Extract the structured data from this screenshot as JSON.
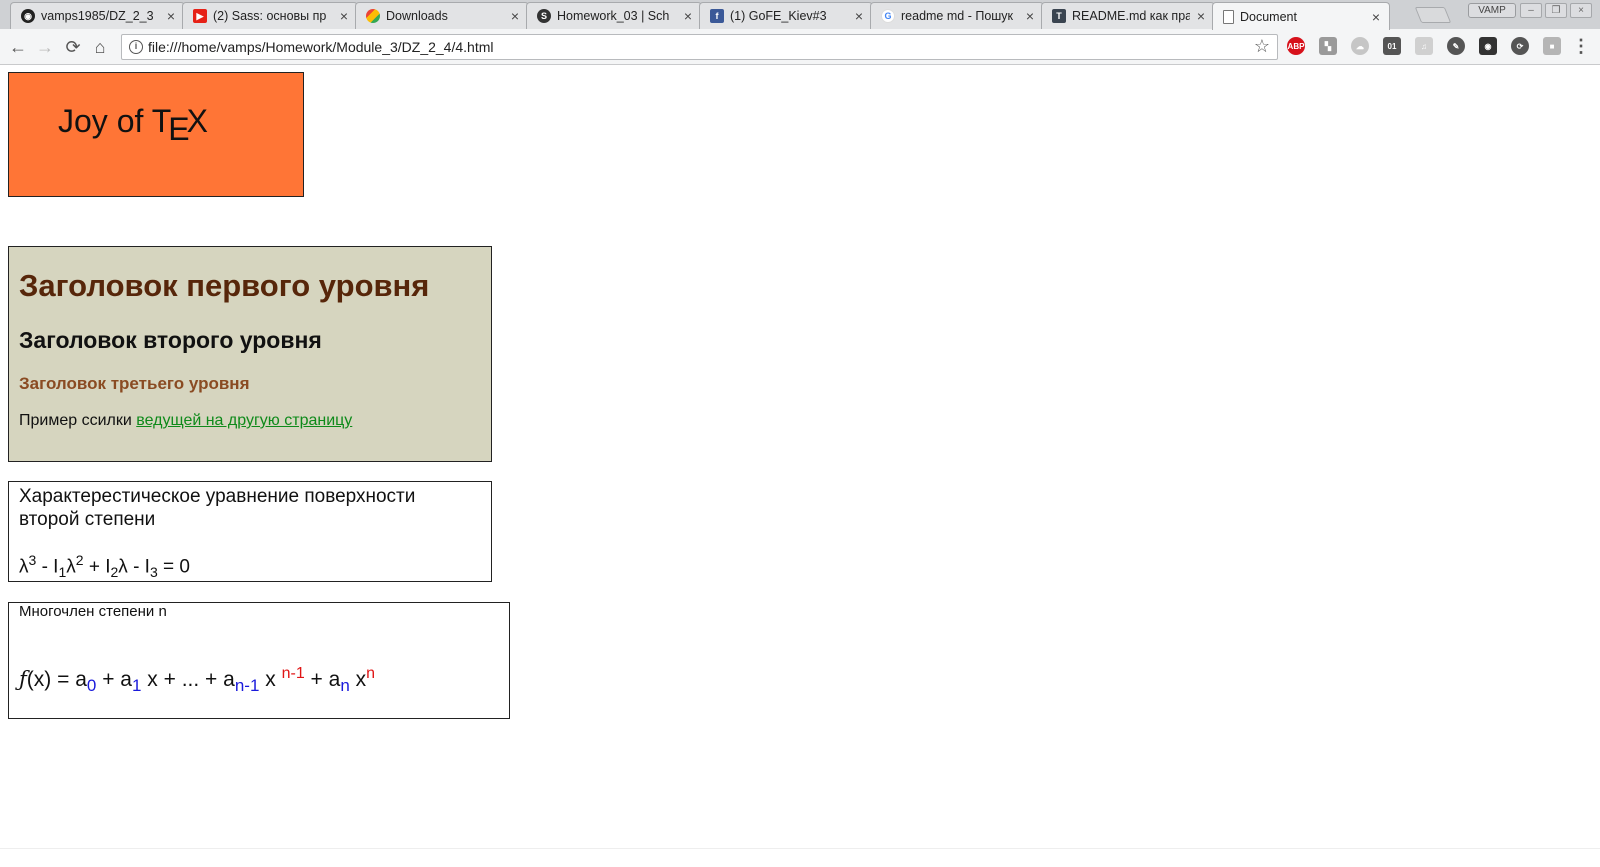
{
  "browser": {
    "tabs": [
      {
        "title": "vamps1985/DZ_2_3",
        "favicon": "github-icon",
        "color": "#222222",
        "glyph": "⬤"
      },
      {
        "title": "(2) Sass: основы пр",
        "favicon": "youtube-icon",
        "color": "#e62117",
        "glyph": "▶"
      },
      {
        "title": "Downloads",
        "favicon": "downloads-icon",
        "color": "#4285f4",
        "glyph": "◆"
      },
      {
        "title": "Homework_03 | Sch",
        "favicon": "schoology-icon",
        "color": "#333333",
        "glyph": "S"
      },
      {
        "title": "(1) GoFE_Kiev#3",
        "favicon": "facebook-icon",
        "color": "#3b5998",
        "glyph": "f"
      },
      {
        "title": "readme md - Пошук",
        "favicon": "google-icon",
        "color": "#4285f4",
        "glyph": "G"
      },
      {
        "title": "README.md как пра",
        "favicon": "habr-icon",
        "color": "#3a4450",
        "glyph": "T"
      },
      {
        "title": "Document",
        "favicon": "document-icon",
        "color": "#777777",
        "glyph": "▢"
      }
    ],
    "active_tab_index": 7,
    "profile_label": "VAMP",
    "address": "file:///home/vamps/Homework/Module_3/DZ_2_4/4.html",
    "extensions": [
      {
        "name": "adblock-plus-icon",
        "label": "ABP",
        "color": "#d7111b"
      },
      {
        "name": "feed-icon",
        "label": "▚",
        "color": "#9a9a9a"
      },
      {
        "name": "cloud-icon",
        "label": "☁",
        "color": "#bdbdbd"
      },
      {
        "name": "binary-icon",
        "label": "01",
        "color": "#555555"
      },
      {
        "name": "music-icon",
        "label": "♫",
        "color": "#c9c9c9"
      },
      {
        "name": "feather-icon",
        "label": "✎",
        "color": "#555555"
      },
      {
        "name": "incognito-icon",
        "label": "◉",
        "color": "#333333"
      },
      {
        "name": "sync-icon",
        "label": "⟳",
        "color": "#555555"
      },
      {
        "name": "shield-icon",
        "label": "■",
        "color": "#b5b5b5"
      },
      {
        "name": "menu-icon",
        "label": "⋮",
        "color": "#555555"
      }
    ]
  },
  "page": {
    "tex": {
      "prefix": "Joy of T",
      "e": "E",
      "suffix": "X"
    },
    "headings": {
      "h1": "Заголовок первого уровня",
      "h2": "Заголовок второго уровня",
      "h3": "Заголовок третьего уровня",
      "link_prefix": "Пример ссилки",
      "link_text": "ведущей на другую страницу"
    },
    "equation": {
      "caption": "Характерестическое уравнение поверхности второй степени",
      "parts": {
        "lambda": "λ",
        "p3": "3",
        "minus_i": " - I",
        "s1": "1",
        "lambda2": "λ",
        "p2": "2",
        "plus_i": " + I",
        "s2": "2",
        "lambda3": "λ",
        "minus_i3": " - I",
        "s3": "3",
        "eq0": " = 0"
      }
    },
    "polynomial": {
      "caption": "Многочлен степени n",
      "parts": {
        "f": "ƒ",
        "fx": "(x) = a",
        "s0": "0",
        "plus_a1": " + a",
        "s1": "1",
        "x_dots": " x + ... + a",
        "sn1": "n-1",
        "x1": " x ",
        "pn1": "n-1",
        "plus_an": " + a",
        "sn": "n",
        "x2": " x",
        "pn": "n"
      }
    }
  }
}
